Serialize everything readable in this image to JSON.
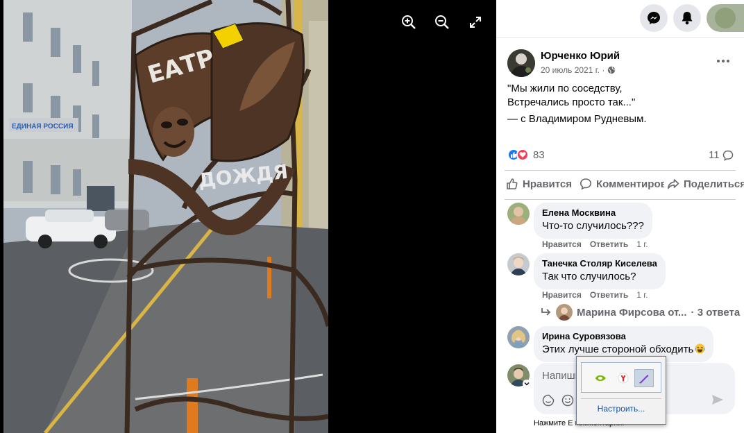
{
  "viewer": {
    "photo_sign_text": "ТЕАТР ДОЖДЯ",
    "building_sign": "ЕДИНАЯ РОССИЯ"
  },
  "post": {
    "author": "Юрченко Юрий",
    "date": "20 июль 2021 г. ·",
    "text_line1": "\"Мы жили по соседству,",
    "text_line2": "Встречались просто так...\"",
    "with_prefix": "— с ",
    "with_person": "Владимиром Рудневым",
    "with_suffix": ".",
    "reactions_count": "83",
    "comments_count": "11"
  },
  "actions": {
    "like": "Нравится",
    "comment": "Комментировать",
    "share": "Поделиться"
  },
  "comments": [
    {
      "author": "Елена Москвина",
      "text": "Что-то случилось???",
      "like": "Нравится",
      "reply": "Ответить",
      "age": "1 г."
    },
    {
      "author": "Танечка Столяр Киселева",
      "text": "Так что случилось?",
      "like": "Нравится",
      "reply": "Ответить",
      "age": "1 г."
    },
    {
      "author": "Ирина Суровязова",
      "text": "Этих лучше стороной обходить"
    }
  ],
  "replies": {
    "name": "Марина Фирсова от...",
    "count": "· 3 ответа"
  },
  "input": {
    "placeholder": "Напиши",
    "footer": "Нажмите E                                    комментарий."
  },
  "tray": {
    "configure": "Настроить..."
  },
  "colors": {
    "accent": "#1877f2",
    "like_blue": "#1877f2",
    "love_red": "#f33e58"
  }
}
